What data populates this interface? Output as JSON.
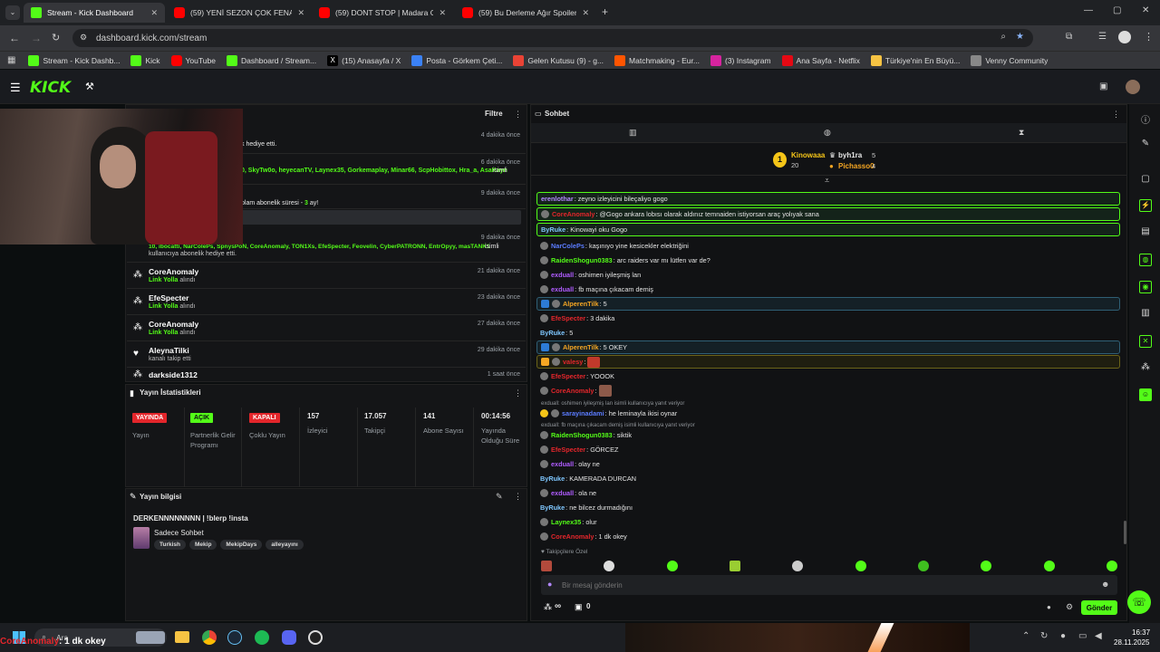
{
  "browser": {
    "tabs": [
      {
        "title": "Stream - Kick Dashboard",
        "active": true,
        "icon": "kick"
      },
      {
        "title": "(59) YENİ SEZON ÇOK FENA BA",
        "active": false,
        "icon": "youtube"
      },
      {
        "title": "(59) DONT STOP | Madara Oldu",
        "active": false,
        "icon": "youtube"
      },
      {
        "title": "(59) Bu Derleme Ağır Spoiler İç",
        "active": false,
        "icon": "youtube"
      }
    ],
    "url": "dashboard.kick.com/stream",
    "bookmarks": [
      "Stream - Kick Dashb...",
      "Kick",
      "YouTube",
      "Dashboard / Stream...",
      "(15) Anasayfa / X",
      "Posta - Görkem Çeti...",
      "Gelen Kutusu (9) - g...",
      "Matchmaking - Eur...",
      "(3) Instagram",
      "Ana Sayfa - Netflix",
      "Türkiye'nin En Büyü...",
      "Venny Community"
    ]
  },
  "activity": {
    "filter_label": "Filtre",
    "events": [
      {
        "time": "4 dakika önce",
        "text": "k hediye etti."
      },
      {
        "time": "6 dakika önce",
        "names": "0, SkyTw0o, heyecanTV, Laynex35, Gorkemaplay, Minar66, ScpHobittox, Hra_a, AsaKayn",
        "tail": "isimli"
      },
      {
        "time": "9 dakika önce",
        "text": "olam abonelik süresi - ",
        "count": "3",
        "suffix": " ay!"
      },
      {
        "time": "9 dakika önce",
        "names": "10, ibocatti, NarColePs, SpnysPoN, CoreAnomaly, TON1Xs, EfeSpecter, Feovelin, CyberPATRONN, EntrOpyy, masTANK1",
        "tail": "isimli",
        "sub": "kullanıcıya abonelik hediye etti."
      },
      {
        "name": "CoreAnomaly",
        "link": "Link Yolla",
        "sub": "alındı",
        "time": "21 dakika önce"
      },
      {
        "name": "EfeSpecter",
        "link": "Link Yolla",
        "sub": "alındı",
        "time": "23 dakika önce"
      },
      {
        "name": "CoreAnomaly",
        "link": "Link Yolla",
        "sub": "alındı",
        "time": "27 dakika önce"
      },
      {
        "name": "AleynaTilki",
        "sub": "kanalı takip etti",
        "time": "29 dakika önce"
      },
      {
        "name": "darkside1312",
        "time": "1 saat önce"
      }
    ]
  },
  "stats": {
    "title": "Yayın İstatistikleri",
    "items": [
      {
        "badge": "YAYINDA",
        "label": "Yayın",
        "color": "#e3262b"
      },
      {
        "badge": "AÇIK",
        "label": "Partnerlik Gelir Programı",
        "color": "#53fc18"
      },
      {
        "badge": "KAPALI",
        "label": "Çoklu Yayın",
        "color": "#e3262b"
      },
      {
        "value": "157",
        "label": "İzleyici"
      },
      {
        "value": "17.057",
        "label": "Takipçi"
      },
      {
        "value": "141",
        "label": "Abone Sayısı"
      },
      {
        "value": "00:14:56",
        "label": "Yayında Olduğu Süre"
      }
    ]
  },
  "stream_info": {
    "title": "Yayın bilgisi",
    "stream_title": "DERKENNNNNNNN | !blerp !insta",
    "category": "Sadece Sohbet",
    "tags": [
      "Turkish",
      "Mekip",
      "MekipDays",
      "alleyayını"
    ]
  },
  "chat": {
    "title": "Sohbet",
    "leaderboard": [
      {
        "rank": "1",
        "name": "Kinowaaa",
        "value": "20"
      },
      {
        "name": "byh1ra",
        "value": "5"
      },
      {
        "name": "Pichasso0",
        "value": "4"
      }
    ],
    "messages": [
      {
        "user": "erenlothar",
        "color": "#b388ff",
        "text": "zeyno izleyicini bileçaliyo gogo",
        "style": "hl"
      },
      {
        "user": "CoreAnomaly",
        "color": "#e3262b",
        "text": "@Gogo ankara lobısı olarak aldınız temnaiden istiyorsan araç yolıyak sana",
        "style": "hl"
      },
      {
        "user": "ByRuke",
        "color": "#7fc7ff",
        "text": "Kinowayi oku Gogo",
        "style": "hl"
      },
      {
        "user": "NarColePs",
        "color": "#5b7cff",
        "text": "kaşınıyo yine kesicekler elektriğini"
      },
      {
        "user": "RaidenShogun0383",
        "color": "#53fc18",
        "text": "arc raiders var mı lütfen var de?"
      },
      {
        "user": "exduall",
        "color": "#b05cff",
        "text": "oshimen iyileşmiş lan"
      },
      {
        "user": "exduall",
        "color": "#b05cff",
        "text": "fb maçına çıkacam demiş"
      },
      {
        "user": "AlperenTilk",
        "color": "#f5a623",
        "text": "5",
        "style": "hb"
      },
      {
        "user": "EfeSpecter",
        "color": "#e3262b",
        "text": "3 dakika"
      },
      {
        "user": "ByRuke",
        "color": "#7fc7ff",
        "text": "5"
      },
      {
        "user": "AlperenTilk",
        "color": "#f5a623",
        "text": "5 OKEY",
        "style": "hb"
      },
      {
        "user": "valesy",
        "color": "#e3262b",
        "text": "",
        "style": "hy"
      },
      {
        "user": "EfeSpecter",
        "color": "#e3262b",
        "text": "YOOOK"
      },
      {
        "user": "CoreAnomaly",
        "color": "#e3262b",
        "text": ""
      },
      {
        "user": "sarayinadami",
        "color": "#5b7cff",
        "text": "he leminayla ikisi oynar",
        "reply": "exduall: oshimen iyileşmiş lan isimli kullanıcıya yanıt veriyor"
      },
      {
        "user": "RaidenShogun0383",
        "color": "#53fc18",
        "text": "siktik",
        "reply": "exduall: fb maçına çıkacam demiş isimli kullanıcıya yanıt veriyor"
      },
      {
        "user": "EfeSpecter",
        "color": "#e3262b",
        "text": "GÖRCEZ"
      },
      {
        "user": "exduall",
        "color": "#b05cff",
        "text": "olay ne"
      },
      {
        "user": "ByRuke",
        "color": "#7fc7ff",
        "text": "KAMERADA DURCAN"
      },
      {
        "user": "exduall",
        "color": "#b05cff",
        "text": "ola ne"
      },
      {
        "user": "ByRuke",
        "color": "#7fc7ff",
        "text": "ne bilcez durmadığını"
      },
      {
        "user": "Laynex35",
        "color": "#53fc18",
        "text": "olur"
      },
      {
        "user": "CoreAnomaly",
        "color": "#e3262b",
        "text": "1 dk okey"
      }
    ],
    "followers_label": "Takipçilere Özel",
    "input_placeholder": "Bir mesaj gönderin",
    "send_label": "Gönder",
    "footer_infinity": "∞",
    "footer_count": "0"
  },
  "taskbar": {
    "search_label": "Ara",
    "overlay_user": "CoreAnomaly",
    "overlay_text": ": 1 dk okey",
    "time": "16:37",
    "date": "28.11.2025"
  }
}
